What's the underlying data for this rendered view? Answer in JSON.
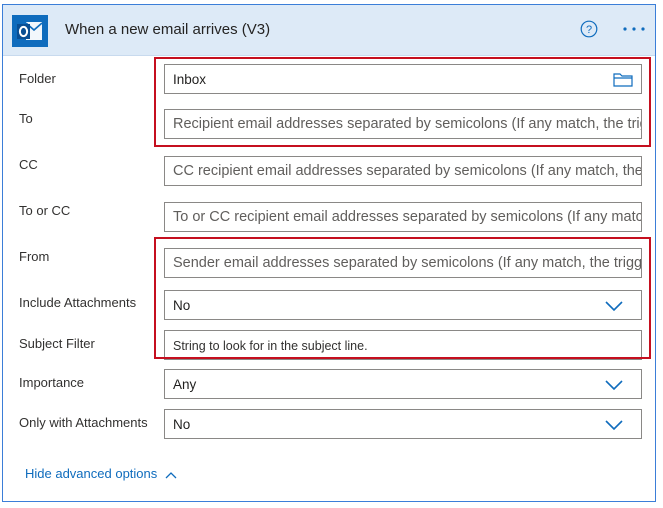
{
  "header": {
    "title": "When a new email arrives (V3)",
    "accent": "#0f6cbd",
    "icons": {
      "app": "outlook-icon",
      "help": "help-icon",
      "more": "more-options-icon"
    }
  },
  "fields": {
    "folder": {
      "label": "Folder",
      "value": "Inbox",
      "icon": "folder-icon"
    },
    "to": {
      "label": "To",
      "placeholder": "Recipient email addresses separated by semicolons (If any match, the trigger will run)"
    },
    "cc": {
      "label": "CC",
      "placeholder": "CC recipient email addresses separated by semicolons (If any match, the trigger will run)"
    },
    "to_or_cc": {
      "label": "To or CC",
      "placeholder": "To or CC recipient email addresses separated by semicolons (If any match, the trigger will run)"
    },
    "from": {
      "label": "From",
      "placeholder": "Sender email addresses separated by semicolons (If any match, the trigger will run)"
    },
    "include_attachments": {
      "label": "Include Attachments",
      "value": "No"
    },
    "subject_filter": {
      "label": "Subject Filter",
      "placeholder": "String to look for in the subject line."
    },
    "importance": {
      "label": "Importance",
      "value": "Any"
    },
    "only_with_attachments": {
      "label": "Only with Attachments",
      "value": "No"
    }
  },
  "footer": {
    "toggle_label": "Hide advanced options"
  },
  "highlight_color": "#c50f1f"
}
